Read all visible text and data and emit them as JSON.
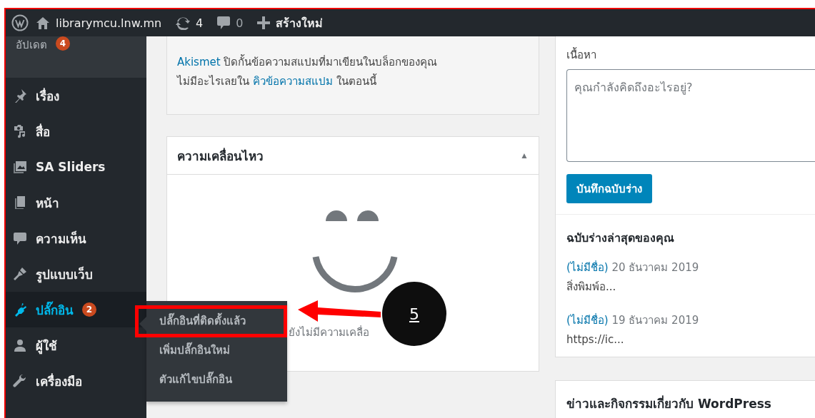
{
  "admin_bar": {
    "site_name": "librarymcu.lnw.mn",
    "updates_count": "4",
    "comments_count": "0",
    "new_label": "สร้างใหม่"
  },
  "sidebar": {
    "sections": [
      {
        "items": [
          {
            "kind": "updates",
            "label": "อัปเดต",
            "badge": "4",
            "selected": false
          }
        ]
      },
      {
        "items": [
          {
            "kind": "posts",
            "label": "เรื่อง",
            "selected": false
          },
          {
            "kind": "media",
            "label": "สื่อ",
            "selected": false
          },
          {
            "kind": "sliders",
            "label": "SA Sliders",
            "selected": false
          },
          {
            "kind": "pages",
            "label": "หน้า",
            "selected": false
          },
          {
            "kind": "comments",
            "label": "ความเห็น",
            "selected": false
          }
        ]
      },
      {
        "items": [
          {
            "kind": "appearance",
            "label": "รูปแบบเว็บ",
            "selected": false
          },
          {
            "kind": "plugins",
            "label": "ปลั๊กอิน",
            "badge": "2",
            "selected": true
          },
          {
            "kind": "users",
            "label": "ผู้ใช้",
            "selected": false
          },
          {
            "kind": "tools",
            "label": "เครื่องมือ",
            "selected": false
          }
        ]
      }
    ]
  },
  "flyout_menu": {
    "items": [
      {
        "label": "ปลั๊กอินที่ติดตั้งแล้ว",
        "highlighted": true
      },
      {
        "label": "เพิ่มปลั๊กอินใหม่",
        "highlighted": false
      },
      {
        "label": "ตัวแก้ไขปลั๊กอิน",
        "highlighted": false
      }
    ]
  },
  "akismet": {
    "link": "Akismet",
    "line1": " ปิดกั้นข้อความสแปมที่มาเขียนในบล็อกของคุณ",
    "line2_before": "ไม่มีอะไรเลยใน ",
    "queue_link": "คิวข้อความสแปม",
    "line2_after": " ในตอนนี้"
  },
  "activity": {
    "title": "ความเคลื่อนไหว",
    "toggle": "▲",
    "empty_text": "ยังไม่มีความเคลื่อ"
  },
  "quick_draft": {
    "content_label": "เนื้อหา",
    "placeholder": "คุณกำลังคิดถึงอะไรอยู่?",
    "save_button": "บันทึกฉบับร่าง",
    "recent_title": "ฉบับร่างล่าสุดของคุณ",
    "drafts": [
      {
        "title": "(ไม่มีชื่อ)",
        "date": "20 ธันวาคม 2019",
        "excerpt": "สิ่งพิมพ์อ..."
      },
      {
        "title": "(ไม่มีชื่อ)",
        "date": "19 ธันวาคม 2019",
        "excerpt": "https://ic..."
      }
    ]
  },
  "news": {
    "title": "ข่าวและกิจกรรมเกี่ยวกับ WordPress"
  },
  "annotation": {
    "number": "5"
  }
}
